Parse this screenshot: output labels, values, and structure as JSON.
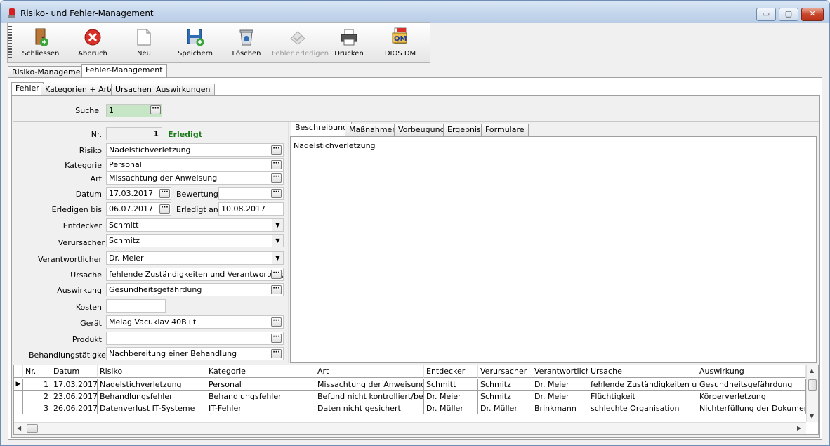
{
  "window": {
    "title": "Risiko- und Fehler-Management",
    "controls": {
      "minimize": "▭",
      "maximize": "▢",
      "close": "✕"
    }
  },
  "toolbar": {
    "items": [
      {
        "label": "Schliessen",
        "icon": "door-exit-icon"
      },
      {
        "label": "Abbruch",
        "icon": "cancel-icon"
      },
      {
        "label": "Neu",
        "icon": "new-document-icon"
      },
      {
        "label": "Speichern",
        "icon": "save-disk-icon"
      },
      {
        "label": "Löschen",
        "icon": "trash-icon"
      },
      {
        "label": "Fehler erledigen",
        "icon": "done-disabled-icon",
        "disabled": true
      },
      {
        "label": "Drucken",
        "icon": "printer-icon"
      },
      {
        "label": "DIOS DM",
        "icon": "qm-pdf-icon"
      }
    ]
  },
  "main_tabs": [
    {
      "label": "Risiko-Management",
      "active": false
    },
    {
      "label": "Fehler-Management",
      "active": true
    }
  ],
  "sub_tabs": [
    {
      "label": "Fehler",
      "active": true
    },
    {
      "label": "Kategorien + Arten",
      "active": false
    },
    {
      "label": "Ursachen",
      "active": false
    },
    {
      "label": "Auswirkungen",
      "active": false
    }
  ],
  "search": {
    "label": "Suche",
    "value": "1"
  },
  "form": {
    "nr_label": "Nr.",
    "nr_value": "1",
    "status": "Erledigt",
    "risiko_label": "Risiko",
    "risiko_value": "Nadelstichverletzung",
    "kategorie_label": "Kategorie",
    "kategorie_value": "Personal",
    "art_label": "Art",
    "art_value": "Missachtung der Anweisung",
    "datum_label": "Datum",
    "datum_value": "17.03.2017",
    "bewertung_label": "Bewertung",
    "bewertung_value": "",
    "erledigen_label": "Erledigen bis",
    "erledigen_value": "06.07.2017",
    "erledigt_label": "Erledigt am",
    "erledigt_value": "10.08.2017",
    "entdecker_label": "Entdecker",
    "entdecker_value": "Schmitt",
    "verursacher_label": "Verursacher",
    "verursacher_value": "Schmitz",
    "verantwortlicher_label": "Verantwortlicher",
    "verantwortlicher_value": "Dr. Meier",
    "ursache_label": "Ursache",
    "ursache_value": "fehlende Zuständigkeiten und Verantwortungen",
    "auswirkung_label": "Auswirkung",
    "auswirkung_value": "Gesundheitsgefährdung",
    "kosten_label": "Kosten",
    "kosten_value": "",
    "geraet_label": "Gerät",
    "geraet_value": "Melag Vacuklav 40B+t",
    "produkt_label": "Produkt",
    "produkt_value": "",
    "behandlung_label": "Behandlungstätigkeit",
    "behandlung_value": "Nachbereitung einer Behandlung"
  },
  "detail_tabs": [
    {
      "label": "Beschreibung",
      "active": true
    },
    {
      "label": "Maßnahmen",
      "active": false
    },
    {
      "label": "Vorbeugung",
      "active": false
    },
    {
      "label": "Ergebnis",
      "active": false
    },
    {
      "label": "Formulare",
      "active": false
    }
  ],
  "description_text": "Nadelstichverletzung",
  "grid": {
    "columns": [
      "Nr.",
      "Datum",
      "Risiko",
      "Kategorie",
      "Art",
      "Entdecker",
      "Verursacher",
      "Verantwortlicher",
      "Ursache",
      "Auswirkung"
    ],
    "rows": [
      [
        "1",
        "17.03.2017",
        "Nadelstichverletzung",
        "Personal",
        "Missachtung der Anweisung",
        "Schmitt",
        "Schmitz",
        "Dr. Meier",
        "fehlende Zuständigkeiten und V",
        "Gesundheitsgefährdung"
      ],
      [
        "2",
        "23.06.2017",
        "Behandlungsfehler",
        "Behandlungsfehler",
        "Befund nicht kontrolliert/beachte",
        "Dr. Meier",
        "Schmitz",
        "Dr. Meier",
        "Flüchtigkeit",
        "Körperverletzung"
      ],
      [
        "3",
        "26.06.2017",
        "Datenverlust IT-Systeme",
        "IT-Fehler",
        "Daten nicht gesichert",
        "Dr. Müller",
        "Dr. Müller",
        "Brinkmann",
        "schlechte Organisation",
        "Nichterfüllung der Dokumentatio"
      ]
    ],
    "current_row": 0
  },
  "colors": {
    "status_green": "#1a7a1a",
    "search_bg": "#c6e6c6",
    "title_gradient": "#c4d6ec"
  }
}
